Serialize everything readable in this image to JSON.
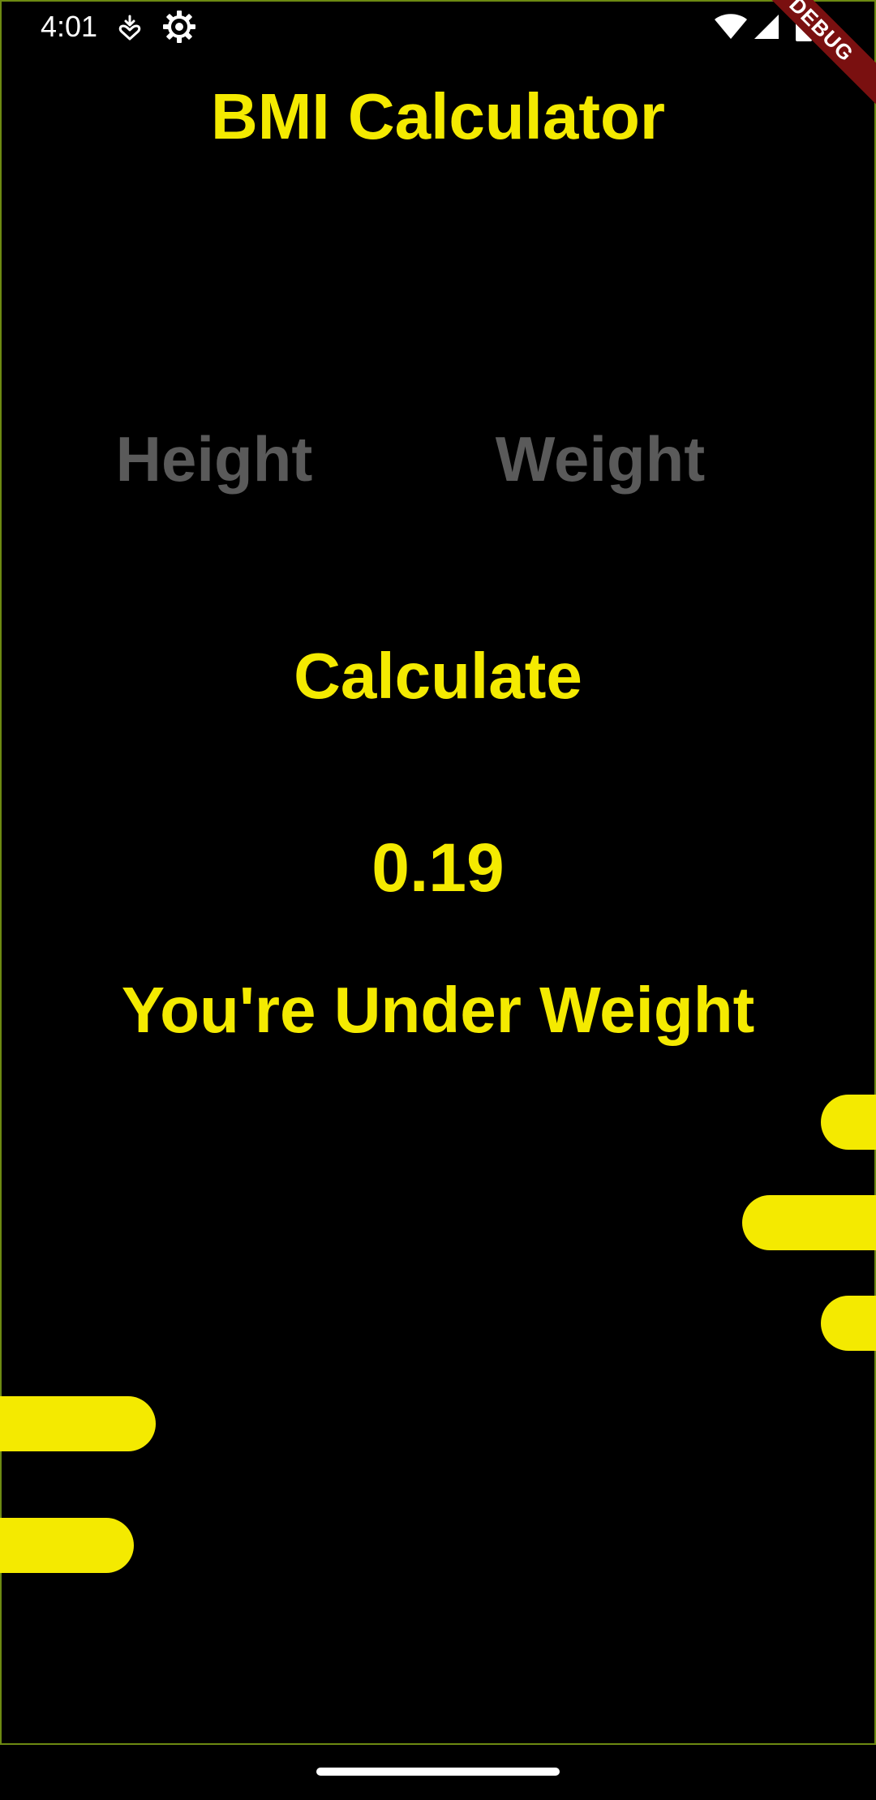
{
  "status_bar": {
    "time": "4:01",
    "icons": [
      "heart-download-icon",
      "gear-icon",
      "wifi-icon",
      "cell-signal-icon",
      "battery-icon"
    ]
  },
  "debug_banner": {
    "label": "DEBUG"
  },
  "app": {
    "title": "BMI Calculator",
    "height_placeholder": "Height",
    "weight_placeholder": "Weight",
    "calculate_label": "Calculate",
    "bmi_value": "0.19",
    "bmi_result": "You're Under Weight"
  },
  "colors": {
    "accent": "#f4ea00",
    "background": "#000000",
    "placeholder": "#5a5a5a",
    "debug_banner": "#7a1010",
    "frame": "#6d8a12"
  }
}
